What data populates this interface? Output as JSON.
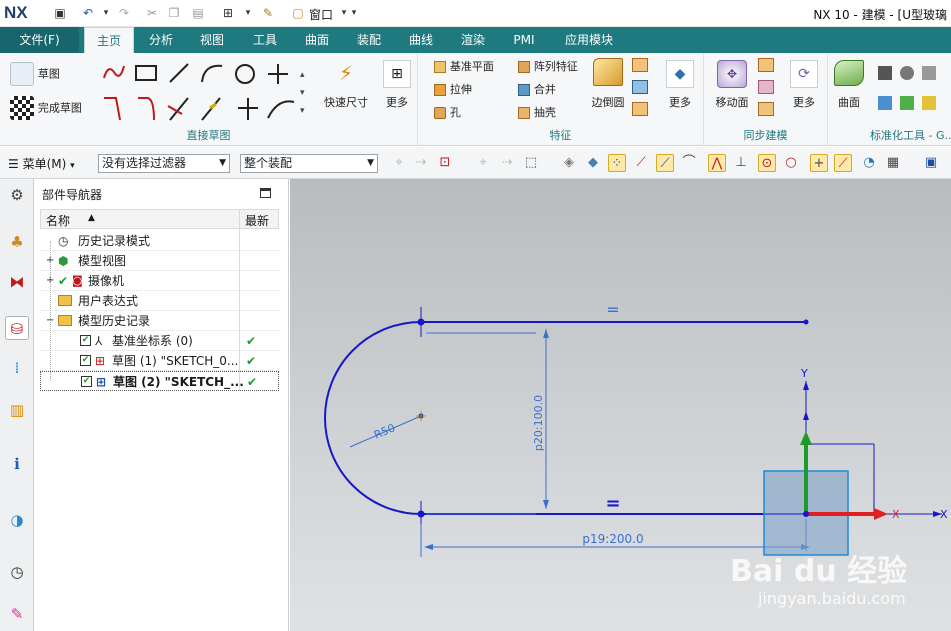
{
  "app": {
    "logo": "NX",
    "window_title": "NX 10 - 建模 - [U型玻璃"
  },
  "quick_access": {
    "window_menu": "窗口"
  },
  "ribbon_tabs": [
    "文件(F)",
    "主页",
    "分析",
    "视图",
    "工具",
    "曲面",
    "装配",
    "曲线",
    "渲染",
    "PMI",
    "应用模块"
  ],
  "ribbon": {
    "sketch_btn": "草图",
    "finish_sketch_btn": "完成草图",
    "quick_dim_btn": "快速尺寸",
    "more1": "更多",
    "group_direct_sketch": "直接草图",
    "datum_plane": "基准平面",
    "extrude": "拉伸",
    "hole": "孔",
    "pattern_feature": "阵列特征",
    "unite": "合并",
    "shell": "抽壳",
    "edge_blend": "边倒圆",
    "more2": "更多",
    "group_feature": "特征",
    "move_face": "移动面",
    "more3": "更多",
    "group_sync": "同步建模",
    "surface": "曲面",
    "group_std": "标准化工具 - G..."
  },
  "toolbar2": {
    "menu": "菜单(M)",
    "filter_select": "没有选择过滤器",
    "scope_select": "整个装配"
  },
  "navigator": {
    "title": "部件导航器",
    "col_name": "名称",
    "col_latest": "最新",
    "rows": [
      {
        "label": "历史记录模式"
      },
      {
        "label": "模型视图"
      },
      {
        "label": "摄像机"
      },
      {
        "label": "用户表达式"
      },
      {
        "label": "模型历史记录"
      },
      {
        "label": "基准坐标系 (0)"
      },
      {
        "label": "草图 (1) \"SKETCH_0..."
      },
      {
        "label": "草图 (2) \"SKETCH_..."
      }
    ]
  },
  "sketch": {
    "dim_radius": "R50",
    "dim_vertical": "p20:100.0",
    "dim_horizontal": "p19:200.0",
    "equal1": "=",
    "equal2": "=",
    "axis_y": "Y",
    "axis_x": "X",
    "axis_x2": "X",
    "watermark_logo": "Bai du 经验",
    "watermark_url": "jingyan.baidu.com"
  },
  "colors": {
    "ribbon_teal": "#1f7a7f",
    "sketch_blue": "#1717c8",
    "axis_red": "#e02020",
    "axis_green": "#1e9a2a"
  }
}
